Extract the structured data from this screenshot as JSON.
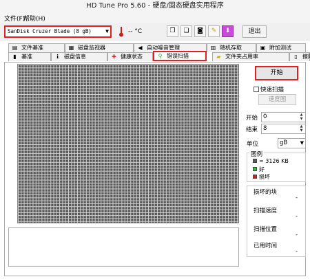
{
  "window": {
    "title": "HD Tune Pro 5.60 - 硬盘/固态硬盘实用程序"
  },
  "menu": {
    "file": "文件(F)",
    "help": "帮助(H)"
  },
  "toolbar": {
    "drive": "SanDisk Cruzer Blade (8 gB)",
    "temperature": "-- °C",
    "exit_label": "退出",
    "buttons": [
      "copy-info-icon",
      "copy-screen-icon",
      "camera-icon",
      "key-icon",
      "download-icon"
    ]
  },
  "tabs_top": [
    {
      "label": "文件基准",
      "icon": "file-icon"
    },
    {
      "label": "磁盘监视器",
      "icon": "monitor-icon"
    },
    {
      "label": "自动噪音管理",
      "icon": "speaker-icon"
    },
    {
      "label": "随机存取",
      "icon": "random-icon"
    },
    {
      "label": "附加测试",
      "icon": "extra-icon"
    }
  ],
  "tabs_bottom": [
    {
      "label": "基准",
      "icon": "benchmark-icon"
    },
    {
      "label": "磁盘信息",
      "icon": "info-icon"
    },
    {
      "label": "健康状态",
      "icon": "health-icon"
    },
    {
      "label": "错误扫描",
      "icon": "magnifier-icon",
      "active": true
    },
    {
      "label": "文件夹占用率",
      "icon": "folder-icon"
    },
    {
      "label": "擦除",
      "icon": "erase-icon"
    }
  ],
  "scan": {
    "start_label": "开始",
    "quick_scan_label": "快速扫描",
    "quick_scan_checked": false,
    "speed_map_label": "速度图",
    "start_field_label": "开始",
    "start_value": "0",
    "end_field_label": "结束",
    "end_value": "8",
    "unit_label": "单位",
    "unit_value": "gB",
    "legend_title": "图例",
    "legend_block": "= 3126 KB",
    "legend_good": "好",
    "legend_bad": "损坏",
    "colors": {
      "block": "#5a5a5a",
      "good": "#2ec02e",
      "bad": "#d62020",
      "accent": "#e02020"
    }
  },
  "stats": [
    {
      "label": "损坏的块",
      "value": "-"
    },
    {
      "label": "扫描速度",
      "value": "-"
    },
    {
      "label": "扫描位置",
      "value": "-"
    },
    {
      "label": "已用时间",
      "value": "-"
    }
  ]
}
